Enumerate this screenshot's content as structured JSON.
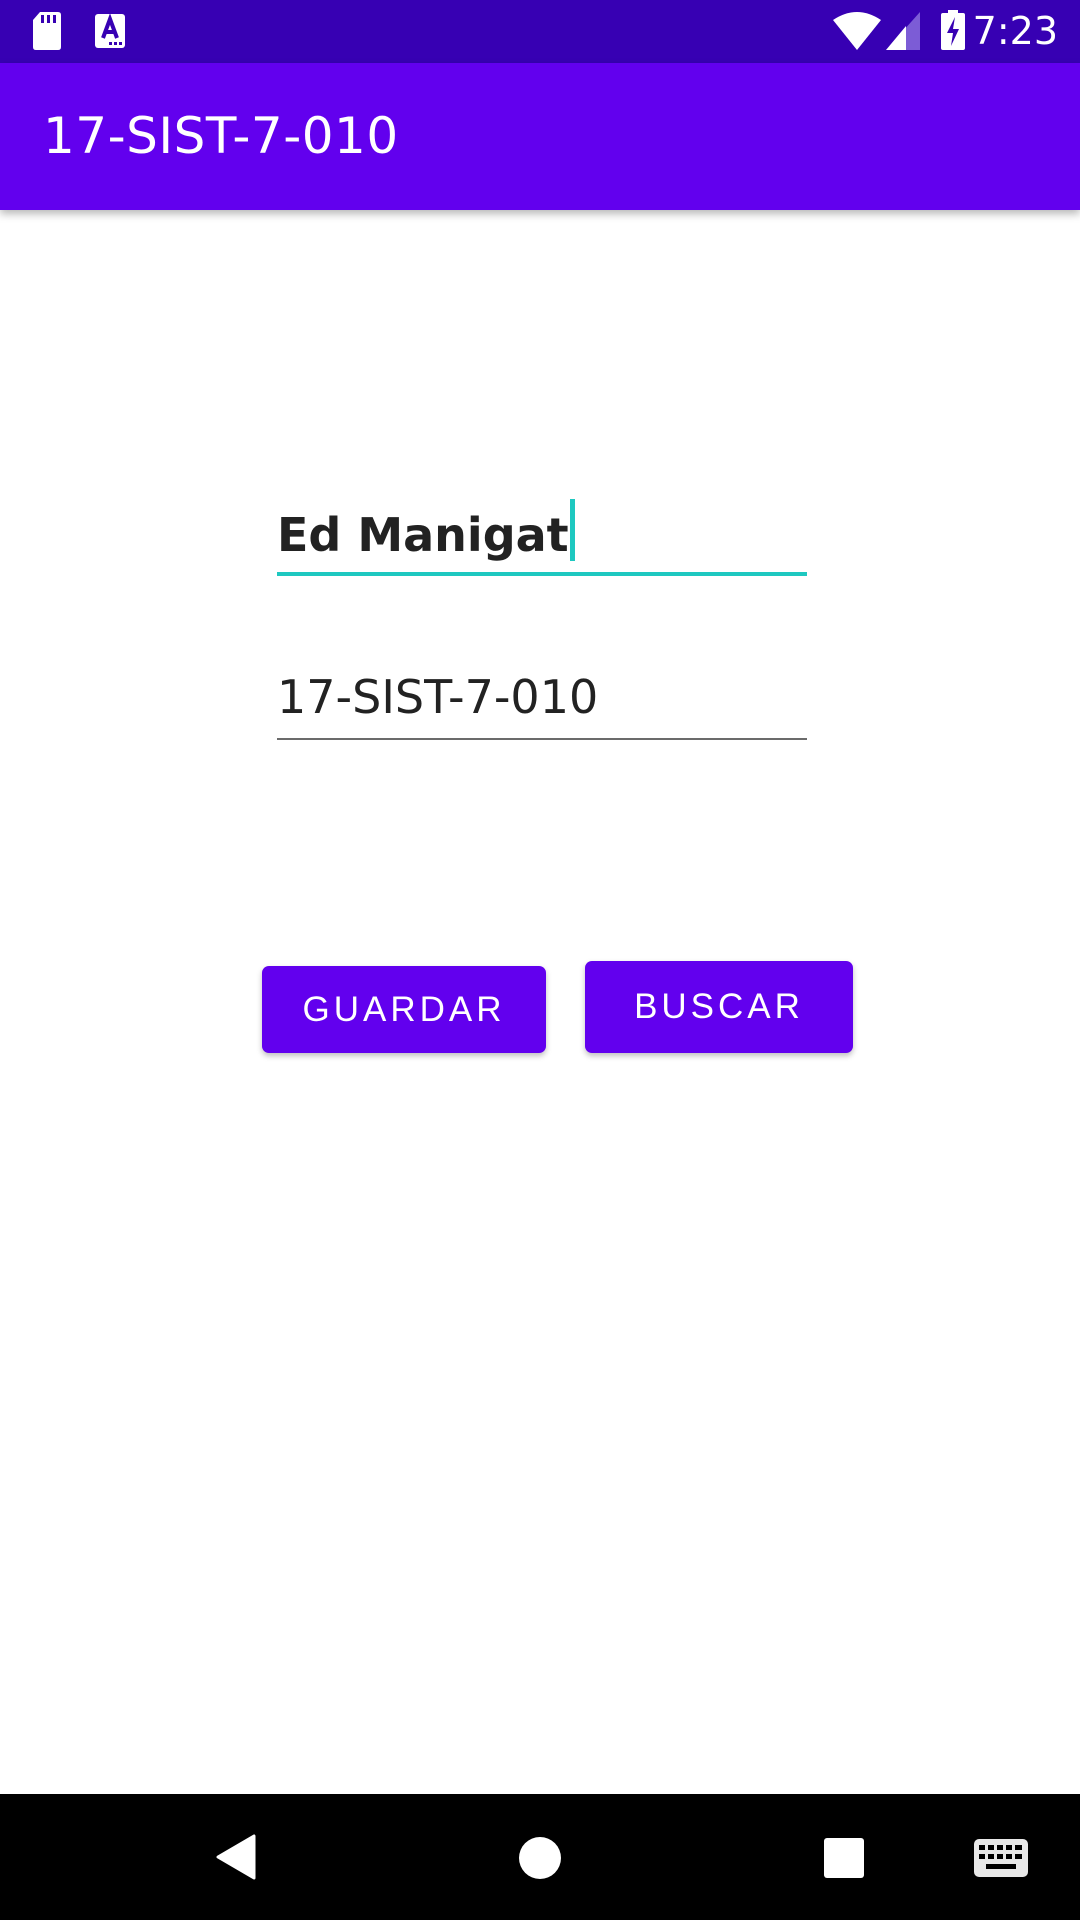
{
  "status_bar": {
    "time": "7:23",
    "icons": [
      "sd-card-icon",
      "accessibility-a-icon",
      "wifi-icon",
      "cell-signal-icon",
      "battery-charging-icon"
    ]
  },
  "app_bar": {
    "title": "17-SIST-7-010",
    "color": "#6200ee"
  },
  "form": {
    "name_value": "Ed Manigat",
    "code_value": "17-SIST-7-010",
    "focus_color": "#1ec8c0"
  },
  "buttons": {
    "save_label": "GUARDAR",
    "search_label": "BUSCAR",
    "color": "#6200ee"
  },
  "nav_bar": {
    "icons": [
      "back-icon",
      "home-icon",
      "recents-icon",
      "keyboard-icon"
    ]
  }
}
